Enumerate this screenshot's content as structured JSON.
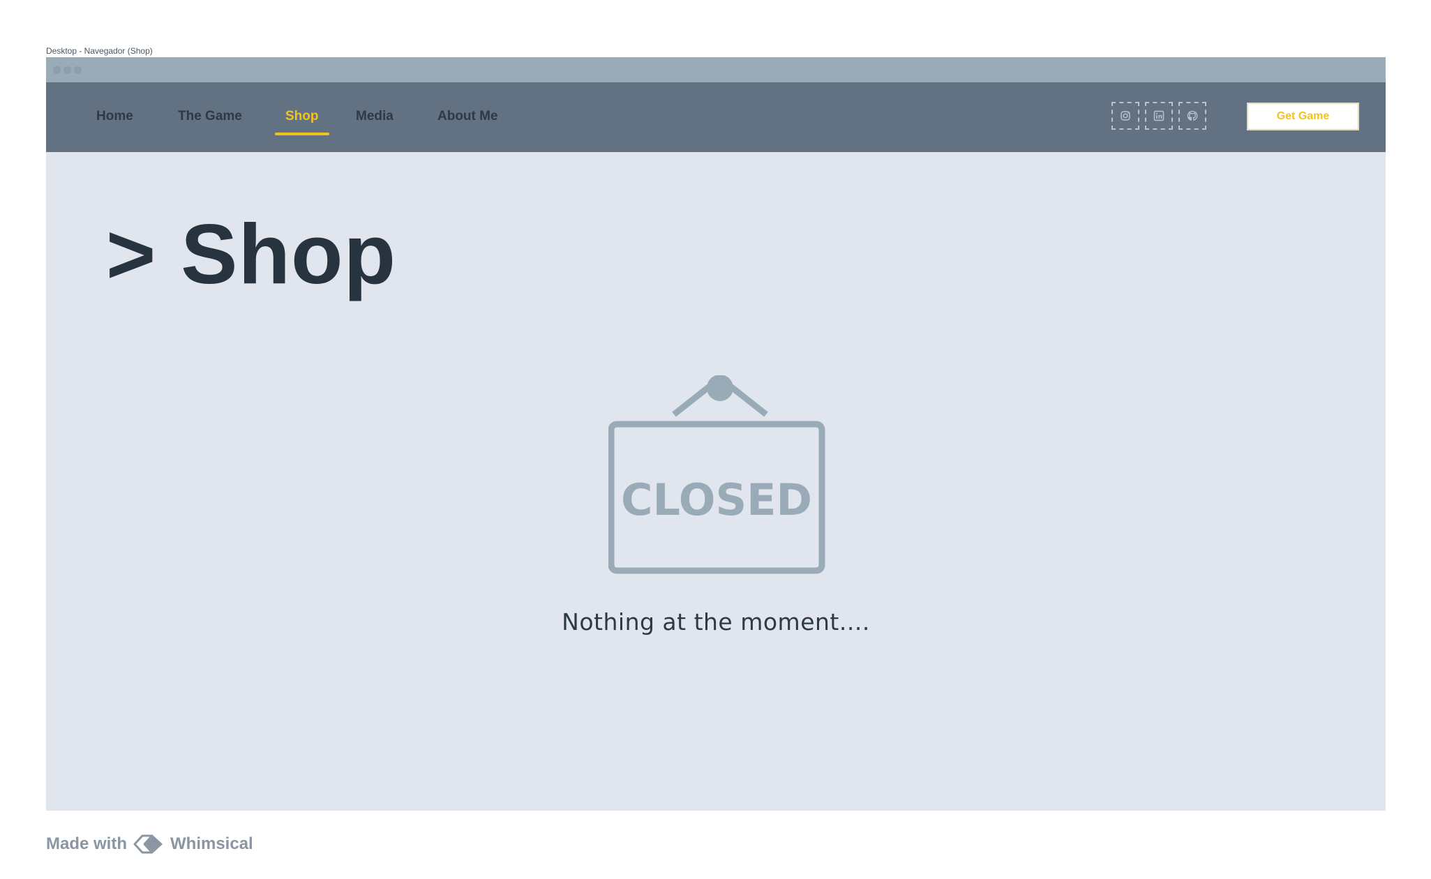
{
  "frame": {
    "label": "Desktop - Navegador (Shop)"
  },
  "nav": {
    "items": [
      {
        "label": "Home"
      },
      {
        "label": "The Game"
      },
      {
        "label": "Shop"
      },
      {
        "label": "Media"
      },
      {
        "label": "About Me"
      }
    ],
    "active_item": "Shop",
    "social": [
      "instagram-icon",
      "linkedin-icon",
      "github-icon"
    ],
    "cta_label": "Get Game"
  },
  "main": {
    "title": "> Shop",
    "sign_text": "CLOSED",
    "empty_message": "Nothing at the moment...."
  },
  "footer": {
    "made_with": "Made with",
    "brand": "Whimsical"
  },
  "colors": {
    "navbar": "#637282",
    "titlebar": "#9aabb8",
    "page_bg": "#e1e6ee",
    "accent": "#f2c320",
    "text_dark": "#27333f",
    "sign": "#9aabb8"
  }
}
